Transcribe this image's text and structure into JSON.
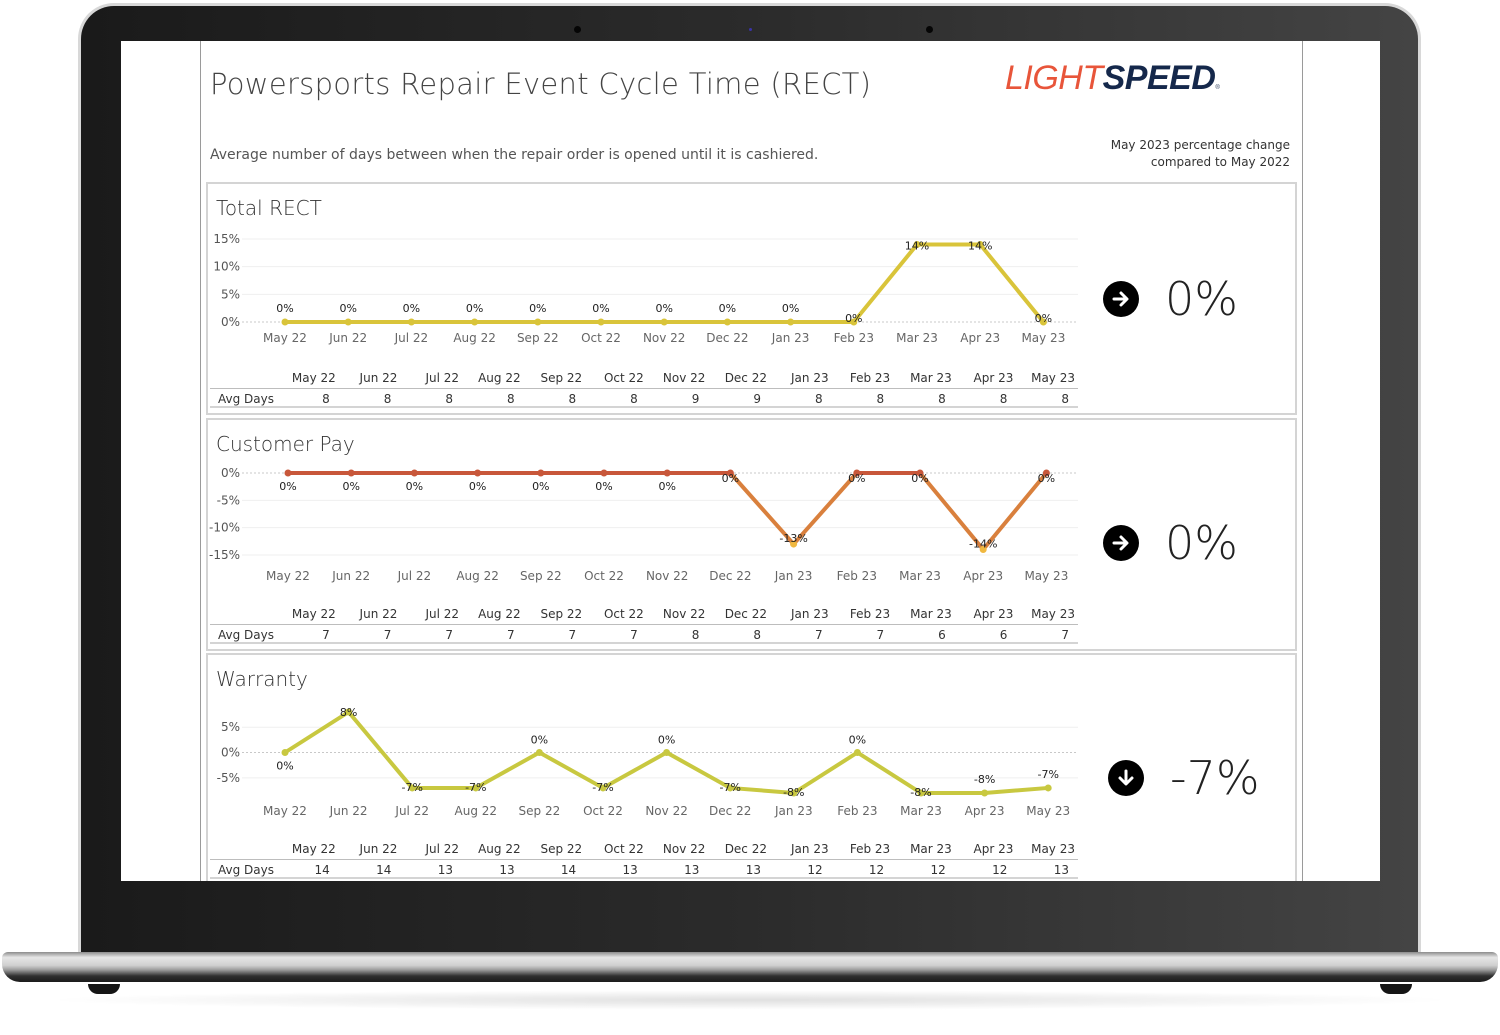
{
  "dashboard": {
    "title": "Powersports Repair Event Cycle Time (RECT)",
    "subtitle": "Average number of days between when the repair order is opened until it is cashiered.",
    "logo": {
      "light": "LIGHT",
      "speed": "SPEED",
      "reg": "®"
    },
    "comparison_note_line1": "May 2023 percentage change",
    "comparison_note_line2": "compared to May 2022",
    "row_label": "Avg Days"
  },
  "colors": {
    "total_line": "#d9c43a",
    "customer_line_start": "#c8573a",
    "customer_line_low": "#f0b840",
    "warranty_line": "#c8c840",
    "logo_light": "#e8553a",
    "logo_speed": "#15284b"
  },
  "chart_data": [
    {
      "type": "line",
      "title": "Total RECT",
      "categories": [
        "May 22",
        "Jun 22",
        "Jul 22",
        "Aug 22",
        "Sep 22",
        "Oct 22",
        "Nov 22",
        "Dec 22",
        "Jan 23",
        "Feb 23",
        "Mar 23",
        "Apr 23",
        "May 23"
      ],
      "series": [
        {
          "name": "% change",
          "values": [
            0,
            0,
            0,
            0,
            0,
            0,
            0,
            0,
            0,
            0,
            14,
            14,
            0
          ]
        }
      ],
      "data_labels": [
        "0%",
        "0%",
        "0%",
        "0%",
        "0%",
        "0%",
        "0%",
        "0%",
        "0%",
        "0%",
        "14%",
        "14%",
        "0%"
      ],
      "yticks": [
        "15%",
        "10%",
        "5%",
        "0%"
      ],
      "ytick_values": [
        15,
        10,
        5,
        0
      ],
      "ylim": [
        0,
        15
      ],
      "avg_days": [
        8,
        8,
        8,
        8,
        8,
        8,
        9,
        9,
        8,
        8,
        8,
        8,
        8
      ],
      "kpi": {
        "value": "0%",
        "icon": "arrow-right-circle-icon"
      }
    },
    {
      "type": "line",
      "title": "Customer Pay",
      "categories": [
        "May 22",
        "Jun 22",
        "Jul 22",
        "Aug 22",
        "Sep 22",
        "Oct 22",
        "Nov 22",
        "Dec 22",
        "Jan 23",
        "Feb 23",
        "Mar 23",
        "Apr 23",
        "May 23"
      ],
      "series": [
        {
          "name": "% change",
          "values": [
            0,
            0,
            0,
            0,
            0,
            0,
            0,
            0,
            -13,
            0,
            0,
            -14,
            0
          ]
        }
      ],
      "data_labels": [
        "0%",
        "0%",
        "0%",
        "0%",
        "0%",
        "0%",
        "0%",
        "0%",
        "-13%",
        "0%",
        "0%",
        "-14%",
        "0%"
      ],
      "yticks": [
        "0%",
        "-5%",
        "-10%",
        "-15%"
      ],
      "ytick_values": [
        0,
        -5,
        -10,
        -15
      ],
      "ylim": [
        -15,
        0
      ],
      "avg_days": [
        7,
        7,
        7,
        7,
        7,
        7,
        8,
        8,
        7,
        7,
        6,
        6,
        7
      ],
      "kpi": {
        "value": "0%",
        "icon": "arrow-right-circle-icon"
      }
    },
    {
      "type": "line",
      "title": "Warranty",
      "categories": [
        "May 22",
        "Jun 22",
        "Jul 22",
        "Aug 22",
        "Sep 22",
        "Oct 22",
        "Nov 22",
        "Dec 22",
        "Jan 23",
        "Feb 23",
        "Mar 23",
        "Apr 23",
        "May 23"
      ],
      "series": [
        {
          "name": "% change",
          "values": [
            0,
            8,
            -7,
            -7,
            0,
            -7,
            0,
            -7,
            -8,
            0,
            -8,
            -8,
            -7
          ]
        }
      ],
      "data_labels": [
        "0%",
        "8%",
        "-7%",
        "-7%",
        "0%",
        "-7%",
        "0%",
        "-7%",
        "-8%",
        "0%",
        "-8%",
        "-8%",
        "-7%"
      ],
      "yticks": [
        "5%",
        "0%",
        "-5%"
      ],
      "ytick_values": [
        5,
        0,
        -5
      ],
      "ylim": [
        -8,
        8
      ],
      "avg_days": [
        14,
        14,
        13,
        13,
        14,
        13,
        13,
        13,
        12,
        12,
        12,
        12,
        13
      ],
      "kpi": {
        "value": "-7%",
        "icon": "arrow-down-circle-icon"
      }
    }
  ]
}
